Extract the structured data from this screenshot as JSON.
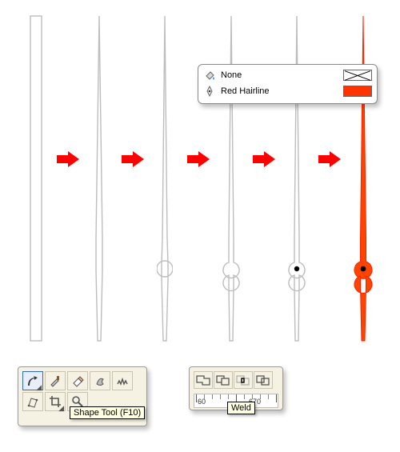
{
  "popup": {
    "fill_label": "None",
    "stroke_label": "Red  Hairline",
    "stroke_color": "#ff3300"
  },
  "tooltips": {
    "shape_tool": "Shape Tool (F10)",
    "weld": "Weld"
  },
  "ruler": {
    "n1": "60",
    "n2": "670"
  },
  "icons": {
    "shape_tool": "shape-tool-icon",
    "knife": "knife-icon",
    "eraser": "eraser-icon",
    "smudge": "smudge-icon",
    "roughen": "roughen-icon",
    "transform": "free-transform-icon",
    "crop": "crop-icon",
    "zoom": "zoom-icon",
    "weld": "weld-icon",
    "trim": "trim-icon",
    "intersect": "intersect-icon",
    "simplify": "simplify-icon",
    "paint_bucket": "paint-bucket-icon",
    "pen_nib": "pen-nib-icon"
  },
  "steps": [
    "rectangle",
    "taper",
    "narrow",
    "circle-outline",
    "circle-weld",
    "circle-dot",
    "final-red"
  ],
  "arrows_count": 5
}
